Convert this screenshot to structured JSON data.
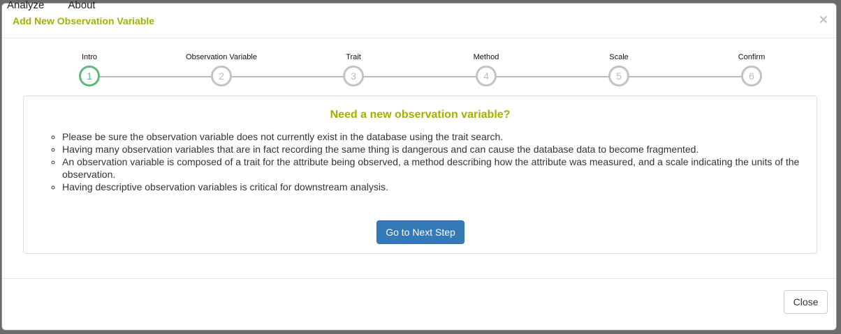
{
  "background": {
    "nav": [
      "Analyze",
      "About"
    ]
  },
  "modal": {
    "title": "Add New Observation Variable",
    "close_icon": "×"
  },
  "steps": [
    {
      "label": "Intro",
      "number": "1",
      "active": true
    },
    {
      "label": "Observation Variable",
      "number": "2"
    },
    {
      "label": "Trait",
      "number": "3"
    },
    {
      "label": "Method",
      "number": "4"
    },
    {
      "label": "Scale",
      "number": "5"
    },
    {
      "label": "Confirm",
      "number": "6"
    }
  ],
  "panel": {
    "heading": "Need a new observation variable?",
    "bullets": [
      "Please be sure the observation variable does not currently exist in the database using the trait search.",
      "Having many observation variables that are in fact recording the same thing is dangerous and can cause the database data to become fragmented.",
      "An observation variable is composed of a trait for the attribute being observed, a method describing how the attribute was measured, and a scale indicating the units of the observation.",
      "Having descriptive observation variables is critical for downstream analysis."
    ],
    "next_label": "Go to Next Step"
  },
  "footer": {
    "close_label": "Close"
  },
  "colors": {
    "title": "#a4b000",
    "active_step": "#5cb97a",
    "primary": "#337ab7"
  }
}
